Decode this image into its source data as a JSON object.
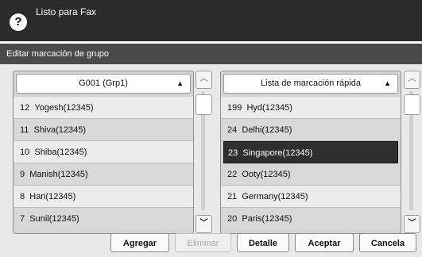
{
  "header": {
    "title": "Listo para Fax",
    "help_icon": "help-icon"
  },
  "subbar": {
    "title": "Editar marcación de grupo"
  },
  "left_panel": {
    "header": "G001 (Grp1)",
    "items": [
      {
        "num": "12",
        "name": "Yogesh(12345)"
      },
      {
        "num": "11",
        "name": "Shiva(12345)"
      },
      {
        "num": "10",
        "name": "Shiba(12345)"
      },
      {
        "num": "9",
        "name": "Manish(12345)"
      },
      {
        "num": "8",
        "name": "Hari(12345)"
      },
      {
        "num": "7",
        "name": "Sunil(12345)"
      }
    ]
  },
  "right_panel": {
    "header": "Lista de marcación rápida",
    "selected_index": 2,
    "items": [
      {
        "num": "199",
        "name": "Hyd(12345)"
      },
      {
        "num": "24",
        "name": "Delhi(12345)"
      },
      {
        "num": "23",
        "name": "Singapore(12345)"
      },
      {
        "num": "22",
        "name": "Ooty(12345)"
      },
      {
        "num": "21",
        "name": "Germany(12345)"
      },
      {
        "num": "20",
        "name": "Paris(12345)"
      }
    ]
  },
  "buttons": {
    "add": "Agregar",
    "delete": "Eliminar",
    "detail": "Detalle",
    "accept": "Aceptar",
    "cancel": "Cancela"
  }
}
